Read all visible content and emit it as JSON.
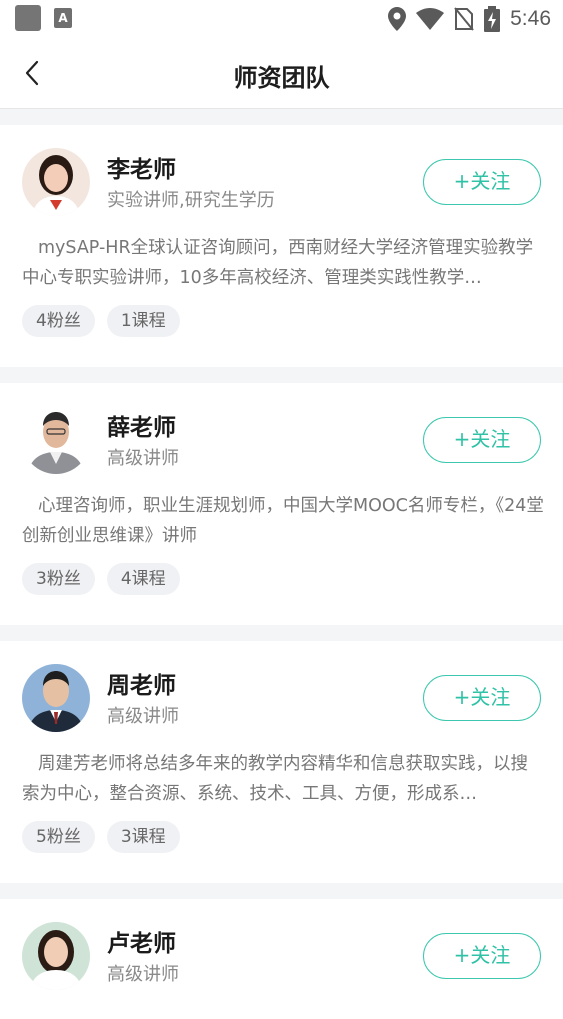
{
  "status_bar": {
    "time": "5:46"
  },
  "header": {
    "title": "师资团队"
  },
  "teachers": [
    {
      "name": "李老师",
      "subtitle": "实验讲师,研究生学历",
      "follow_label": "+关注",
      "description": "mySAP-HR全球认证咨询顾问，西南财经大学经济管理实验教学中心专职实验讲师，10多年高校经济、管理类实践性教学…",
      "fans": "4粉丝",
      "courses": "1课程"
    },
    {
      "name": "薛老师",
      "subtitle": "高级讲师",
      "follow_label": "+关注",
      "description": "心理咨询师，职业生涯规划师，中国大学MOOC名师专栏，《24堂创新创业思维课》讲师",
      "fans": "3粉丝",
      "courses": "4课程"
    },
    {
      "name": "周老师",
      "subtitle": "高级讲师",
      "follow_label": "+关注",
      "description": "周建芳老师将总结多年来的教学内容精华和信息获取实践，以搜索为中心，整合资源、系统、技术、工具、方便，形成系…",
      "fans": "5粉丝",
      "courses": "3课程"
    },
    {
      "name": "卢老师",
      "subtitle": "高级讲师",
      "follow_label": "+关注"
    }
  ],
  "colors": {
    "accent": "#2fc2a6",
    "page_bg": "#f4f5f7"
  }
}
